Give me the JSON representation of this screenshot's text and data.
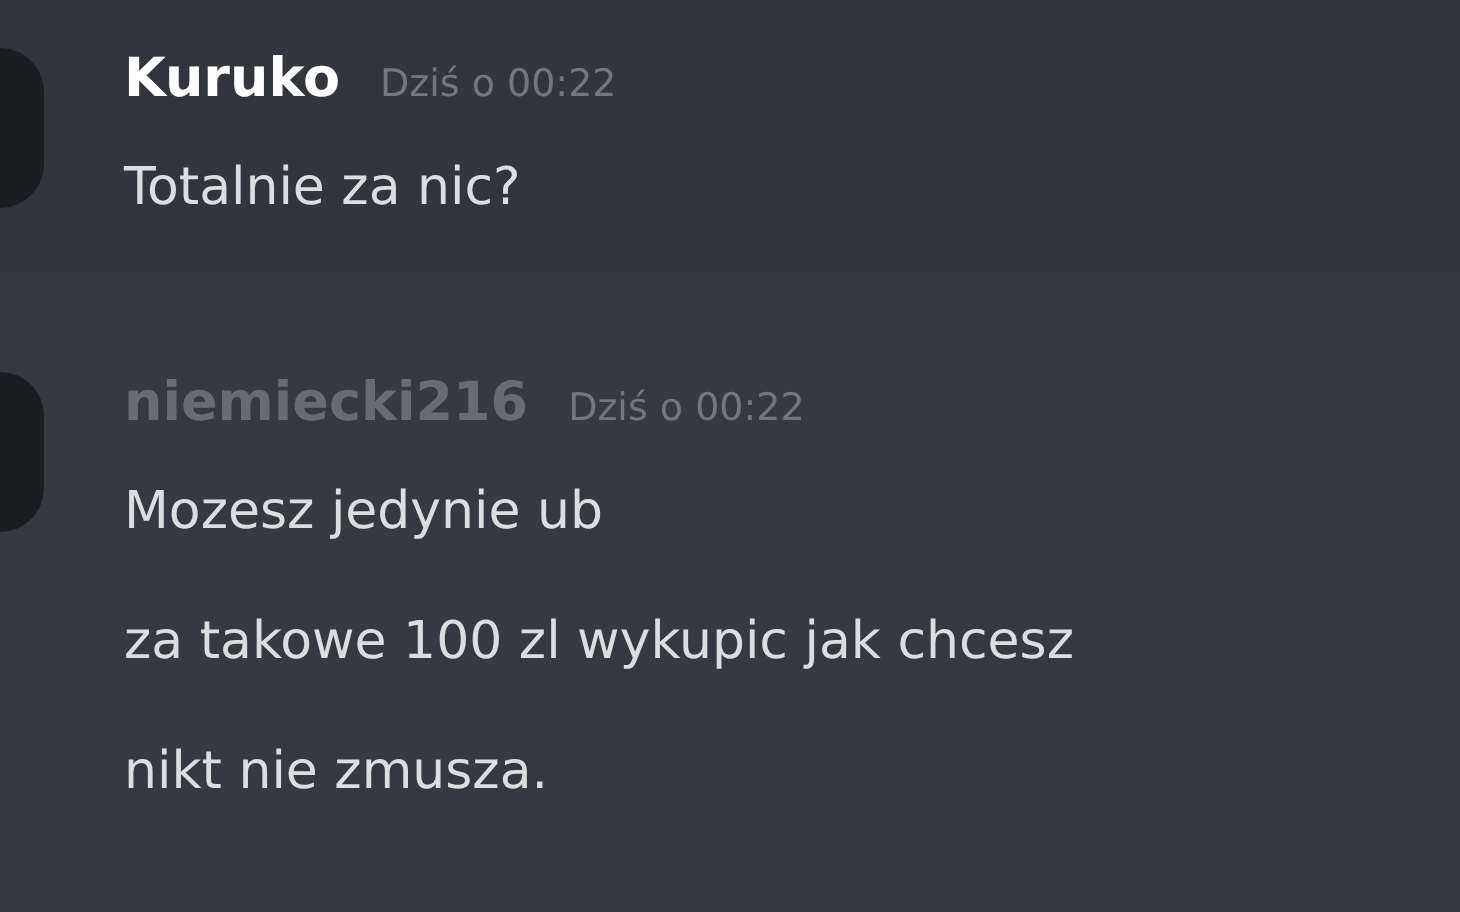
{
  "messages": [
    {
      "author": "Kuruko",
      "color": "#ffffff",
      "timestamp": "Dziś o 00:22",
      "hovered": true,
      "lines": [
        "Totalnie za nic?"
      ]
    },
    {
      "author": "niemiecki216",
      "color": "#686b71",
      "timestamp": "Dziś o 00:22",
      "hovered": false,
      "lines": [
        "Mozesz jedynie ub",
        "za takowe 100 zl wykupic jak chcesz",
        "nikt nie zmusza."
      ]
    }
  ]
}
